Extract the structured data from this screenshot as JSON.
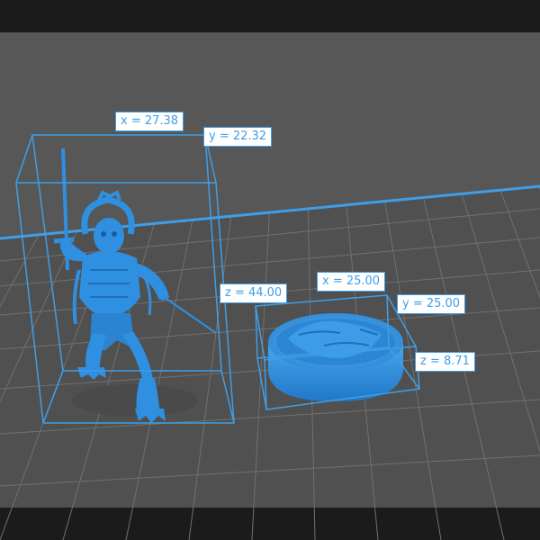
{
  "colors": {
    "frame": "#1b1b1b",
    "background": "#575757",
    "grid": "#6f6f6f",
    "bed_edge": "#3f9ee6",
    "bounding_box": "#3f9ee6",
    "model": "#2f8fe0",
    "label_text": "#3f9ee6",
    "label_bg": "#ffffff"
  },
  "models": [
    {
      "name": "figure",
      "dimensions": {
        "x": "x = 27.38",
        "y": "y = 22.32",
        "z": "z = 44.00"
      }
    },
    {
      "name": "base",
      "dimensions": {
        "x": "x = 25.00",
        "y": "y = 25.00",
        "z": "z = 8.71"
      }
    }
  ]
}
